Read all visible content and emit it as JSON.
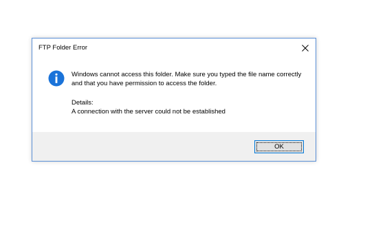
{
  "dialog": {
    "title": "FTP Folder Error",
    "close_icon": "close-icon",
    "info_icon": "info-icon",
    "message": "Windows cannot access this folder. Make sure you typed the file name correctly and that you have permission to access the folder.",
    "details_heading": "Details:",
    "details_text": "A connection with the server could not be established",
    "ok_label": "OK"
  },
  "colors": {
    "border": "#5a8fd6",
    "info_icon": "#1a73d9",
    "footer": "#f0f0f0",
    "button_border": "#0078d7"
  }
}
